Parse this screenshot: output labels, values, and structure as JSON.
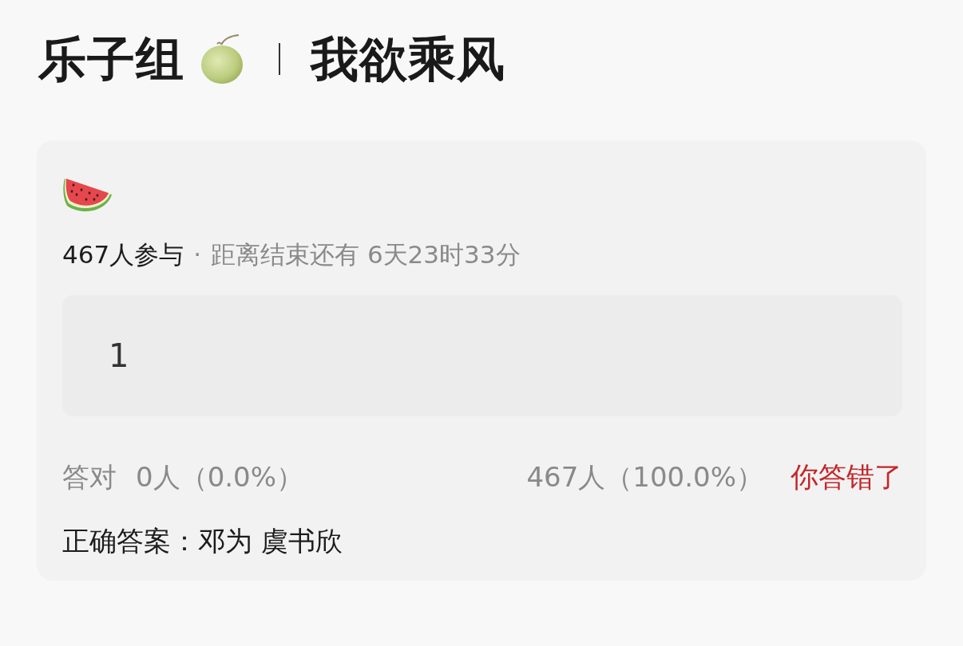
{
  "header": {
    "group": "乐子组",
    "topic": "我欲乘风"
  },
  "quiz": {
    "participants": "467人参与",
    "separator": "·",
    "countdown": "距离结束还有 6天23时33分",
    "answer": {
      "value": "1",
      "correct": false
    },
    "results": {
      "correct_label": "答对",
      "correct_count": "0人（0.0%）",
      "wrong_count": "467人（100.0%）",
      "verdict": "你答错了"
    },
    "correct_answer": "正确答案：邓为 虞书欣"
  }
}
